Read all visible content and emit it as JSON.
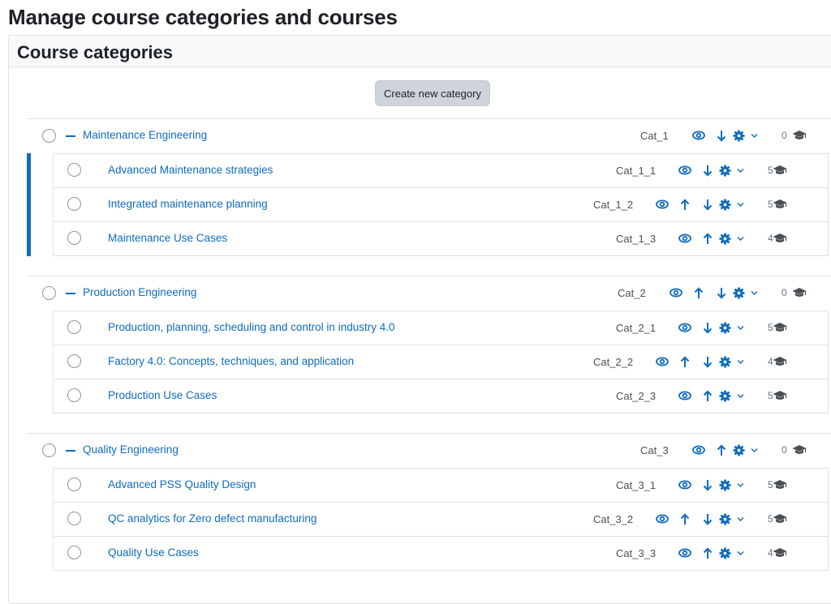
{
  "page": {
    "title": "Manage course categories and courses"
  },
  "panel": {
    "title": "Course categories",
    "create_button": "Create new category"
  },
  "colors": {
    "accent": "#0f6cbf",
    "border": "#dee2e6",
    "button_bg": "#ced4da",
    "text": "#1d2125",
    "muted": "#495057"
  },
  "icons": {
    "collapse": "minus-icon",
    "visibility": "eye-icon",
    "move_up": "arrow-up-icon",
    "move_down": "arrow-down-icon",
    "settings": "gear-icon",
    "dropdown": "chevron-down-icon",
    "courses": "graduation-cap-icon"
  },
  "categories": [
    {
      "name": "Maintenance Engineering",
      "idnumber": "Cat_1",
      "count": "0",
      "active": true,
      "actions": {
        "up": false,
        "down": true
      },
      "children": [
        {
          "name": "Advanced Maintenance strategies",
          "idnumber": "Cat_1_1",
          "count": "5",
          "actions": {
            "up": false,
            "down": true
          }
        },
        {
          "name": "Integrated maintenance planning",
          "idnumber": "Cat_1_2",
          "count": "5",
          "actions": {
            "up": true,
            "down": true
          }
        },
        {
          "name": "Maintenance Use Cases",
          "idnumber": "Cat_1_3",
          "count": "4",
          "actions": {
            "up": true,
            "down": false
          }
        }
      ]
    },
    {
      "name": "Production Engineering",
      "idnumber": "Cat_2",
      "count": "0",
      "active": false,
      "actions": {
        "up": true,
        "down": true
      },
      "children": [
        {
          "name": "Production, planning, scheduling and control in industry 4.0",
          "idnumber": "Cat_2_1",
          "count": "5",
          "actions": {
            "up": false,
            "down": true
          }
        },
        {
          "name": "Factory 4.0: Concepts, techniques, and application",
          "idnumber": "Cat_2_2",
          "count": "4",
          "actions": {
            "up": true,
            "down": true
          }
        },
        {
          "name": "Production Use Cases",
          "idnumber": "Cat_2_3",
          "count": "5",
          "actions": {
            "up": true,
            "down": false
          }
        }
      ]
    },
    {
      "name": "Quality Engineering",
      "idnumber": "Cat_3",
      "count": "0",
      "active": false,
      "actions": {
        "up": true,
        "down": false
      },
      "children": [
        {
          "name": "Advanced PSS Quality Design",
          "idnumber": "Cat_3_1",
          "count": "5",
          "actions": {
            "up": false,
            "down": true
          }
        },
        {
          "name": "QC analytics for Zero defect manufacturing",
          "idnumber": "Cat_3_2",
          "count": "5",
          "actions": {
            "up": true,
            "down": true
          }
        },
        {
          "name": "Quality Use Cases",
          "idnumber": "Cat_3_3",
          "count": "4",
          "actions": {
            "up": true,
            "down": false
          }
        }
      ]
    }
  ]
}
